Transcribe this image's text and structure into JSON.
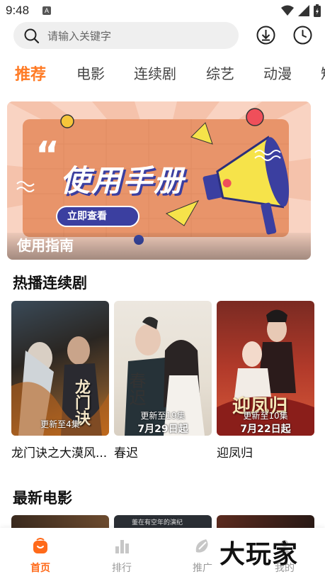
{
  "status_bar": {
    "time": "9:48",
    "notification_glyph": "A"
  },
  "search": {
    "placeholder": "请输入关键字"
  },
  "header_icons": [
    "download-icon",
    "history-clock-icon"
  ],
  "tabs": [
    {
      "label": "推荐",
      "active": true
    },
    {
      "label": "电影"
    },
    {
      "label": "连续剧"
    },
    {
      "label": "综艺"
    },
    {
      "label": "动漫"
    },
    {
      "label": "短"
    }
  ],
  "banner": {
    "headline_quote": "“",
    "headline": "使用手册",
    "button": "立即查看",
    "caption": "使用指南"
  },
  "hot_series": {
    "title": "热播连续剧",
    "items": [
      {
        "name": "龙门诀之大漠风...",
        "badge": "更新至4集",
        "poster_text": "龙门诀"
      },
      {
        "name": "春迟",
        "badge": "更新至19集",
        "date": "7月29日起",
        "poster_text": "春迟"
      },
      {
        "name": "迎凤归",
        "badge": "更新至10集",
        "date": "7月22日起",
        "poster_text": "迎凤归"
      }
    ]
  },
  "latest_movies": {
    "title": "最新电影",
    "thumb2_text": "董在有空年的演纪"
  },
  "bottom_nav": [
    {
      "label": "首页",
      "icon": "home-icon",
      "active": true
    },
    {
      "label": "排行",
      "icon": "ranking-icon"
    },
    {
      "label": "推广",
      "icon": "promote-icon"
    },
    {
      "label": "我的",
      "icon": "profile-icon"
    }
  ],
  "watermark": "大玩家",
  "colors": {
    "accent": "#ff7a24",
    "banner_bg": "#f7c8b4",
    "banner_panel": "#e8946a"
  }
}
